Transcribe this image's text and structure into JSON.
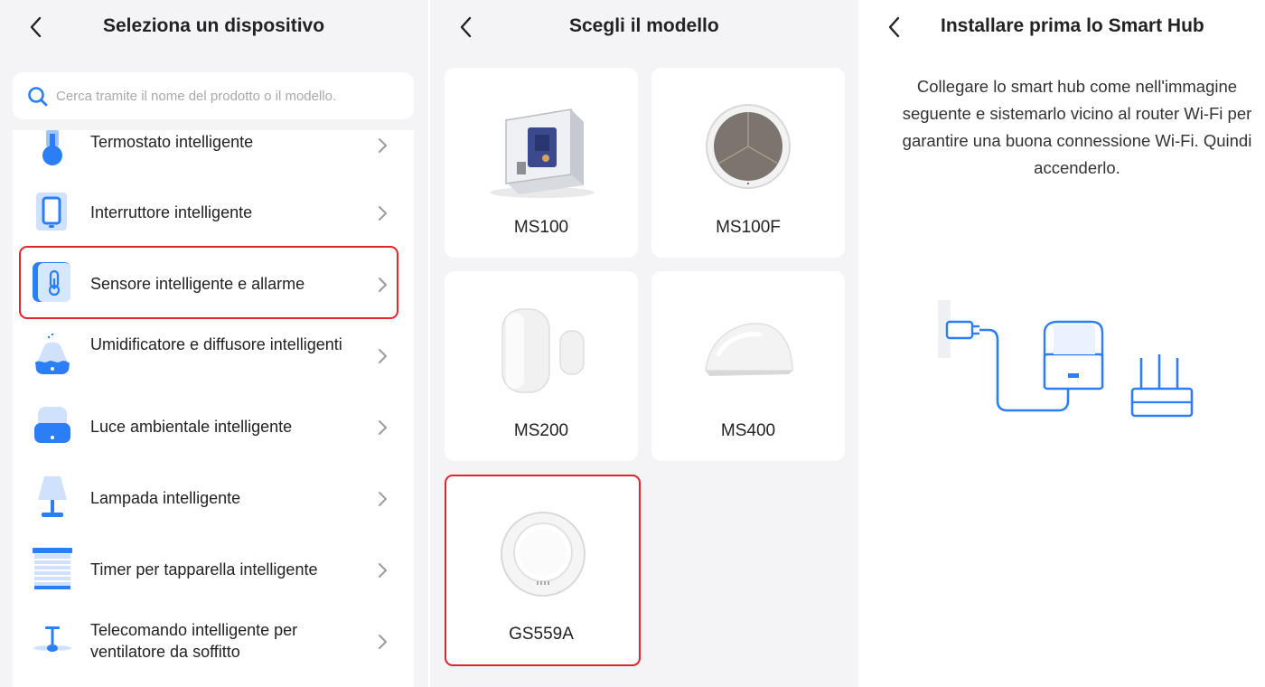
{
  "panel1": {
    "title": "Seleziona un dispositivo",
    "search": {
      "placeholder": "Cerca tramite il nome del prodotto o il modello."
    },
    "items": [
      {
        "label": "Termostato intelligente",
        "icon": "thermostat-icon"
      },
      {
        "label": "Interruttore intelligente",
        "icon": "smart-switch-icon"
      },
      {
        "label": "Sensore intelligente e allarme",
        "icon": "sensor-thermometer-icon",
        "highlighted": true
      },
      {
        "label": "Umidificatore e diffusore intelligenti",
        "icon": "humidifier-icon"
      },
      {
        "label": "Luce ambientale intelligente",
        "icon": "ambient-light-icon"
      },
      {
        "label": "Lampada intelligente",
        "icon": "lamp-icon"
      },
      {
        "label": "Timer per tapparella intelligente",
        "icon": "roller-shutter-icon"
      },
      {
        "label": "Telecomando intelligente per ventilatore da soffitto",
        "icon": "ceiling-fan-icon"
      }
    ]
  },
  "panel2": {
    "title": "Scegli il modello",
    "models": [
      {
        "name": "MS100",
        "image": "hub-device-image"
      },
      {
        "name": "MS100F",
        "image": "round-sensor-image"
      },
      {
        "name": "MS200",
        "image": "door-sensor-image"
      },
      {
        "name": "MS400",
        "image": "dome-sensor-image"
      },
      {
        "name": "GS559A",
        "image": "smoke-detector-image",
        "highlighted": true
      }
    ]
  },
  "panel3": {
    "title": "Installare prima lo Smart Hub",
    "instructions": "Collegare lo smart hub come nell'immagine seguente e sistemarlo vicino al router Wi-Fi per garantire una buona connessione Wi-Fi. Quindi accenderlo.",
    "illustration": "hub-router-connection-illustration"
  },
  "colors": {
    "accent": "#2b7ef6",
    "highlight": "#e0252d",
    "background": "#f4f4f6",
    "text": "#222222"
  }
}
